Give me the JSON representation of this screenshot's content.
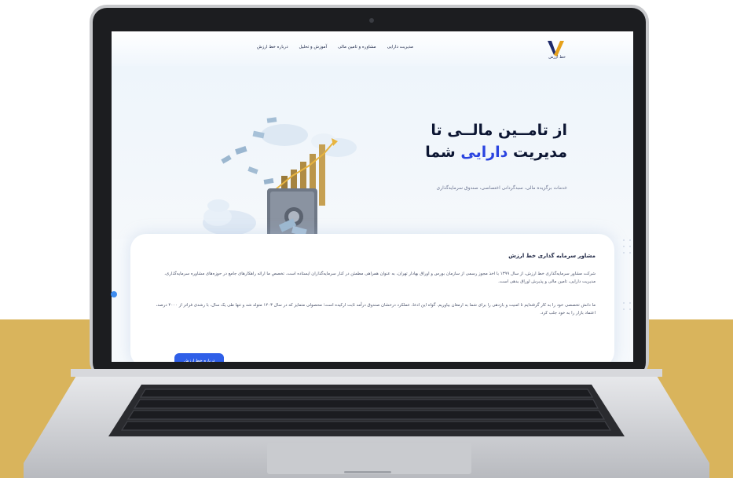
{
  "nav": {
    "brand": "خط ارزش",
    "items": [
      "مدیریت دارایی",
      "مشاوره و تامین مالی",
      "آموزش و تحلیل",
      "درباره خط ارزش"
    ]
  },
  "hero": {
    "title_line1": "از تامــین مالــی تا",
    "title_line2_pre": "مدیریت ",
    "title_line2_accent": "دارایی",
    "title_line2_post": " شما",
    "subtitle": "خدمات برگزیده مالی، سبدگردانی اختصاصی، صندوق سرمایه‌گذاری"
  },
  "about": {
    "title": "مشاور سرمایه گذاری خط ارزش",
    "p1": "شرکت مشاور سرمایه‌گذاری خط ارزش، از سال ۱۳۹۹ با اخذ مجوز رسمی از سازمان بورس و اوراق بهادار تهران، به عنوان همراهی مطمئن در کنار سرمایه‌گذاران ایستاده است. تخصص ما ارائه راهکارهای جامع در حوزه‌های مشاوره سرمایه‌گذاری، مدیریت دارایی، تامین مالی و پذیرش اوراق بدهی است.",
    "p2": "ما دانش تخصصی خود را به کار گرفته‌ایم تا امنیت و بازدهی را برای شما به ارمغان بیاوریم. گواه این ادعا، عملکرد درخشان صندوق درآمد ثابت ارکیده است؛ محصولی متمایز که در سال ۱۴۰۳ متولد شد و تنها طی یک سال، با رشدی فراتر از ۴۰۰۰ درصد، اعتماد بازار را به خود جلب کرد.",
    "button": "درباره خط ارزش"
  },
  "colors": {
    "accent": "#2a43e0",
    "button": "#2f5fe8",
    "background_band": "#d9b45c"
  }
}
